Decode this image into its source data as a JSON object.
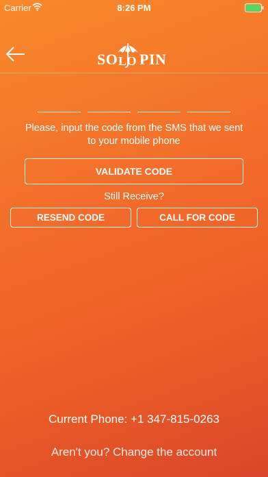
{
  "status_bar": {
    "carrier": "Carrier",
    "time": "8:26 PM",
    "wifi_icon": "wifi-icon",
    "battery_icon": "battery-icon"
  },
  "header": {
    "back_icon": "arrow-left-icon",
    "logo_left": "SO",
    "logo_middle": "LO",
    "logo_right": "PIN"
  },
  "code_input": {
    "slots": [
      "",
      "",
      "",
      ""
    ]
  },
  "main": {
    "instructions": "Please, input the code from the SMS that we sent to your mobile phone",
    "validate_label": "VALIDATE CODE",
    "still_receive": "Still Receive?",
    "resend_label": "RESEND CODE",
    "call_label": "CALL FOR CODE"
  },
  "footer": {
    "current_phone": "Current Phone: +1 347-815-0263",
    "change_account": "Aren't you? Change the account"
  },
  "colors": {
    "gradient_start": "#f8892a",
    "gradient_end": "#d8462a",
    "text": "#ffffff",
    "battery": "#4cd964"
  }
}
